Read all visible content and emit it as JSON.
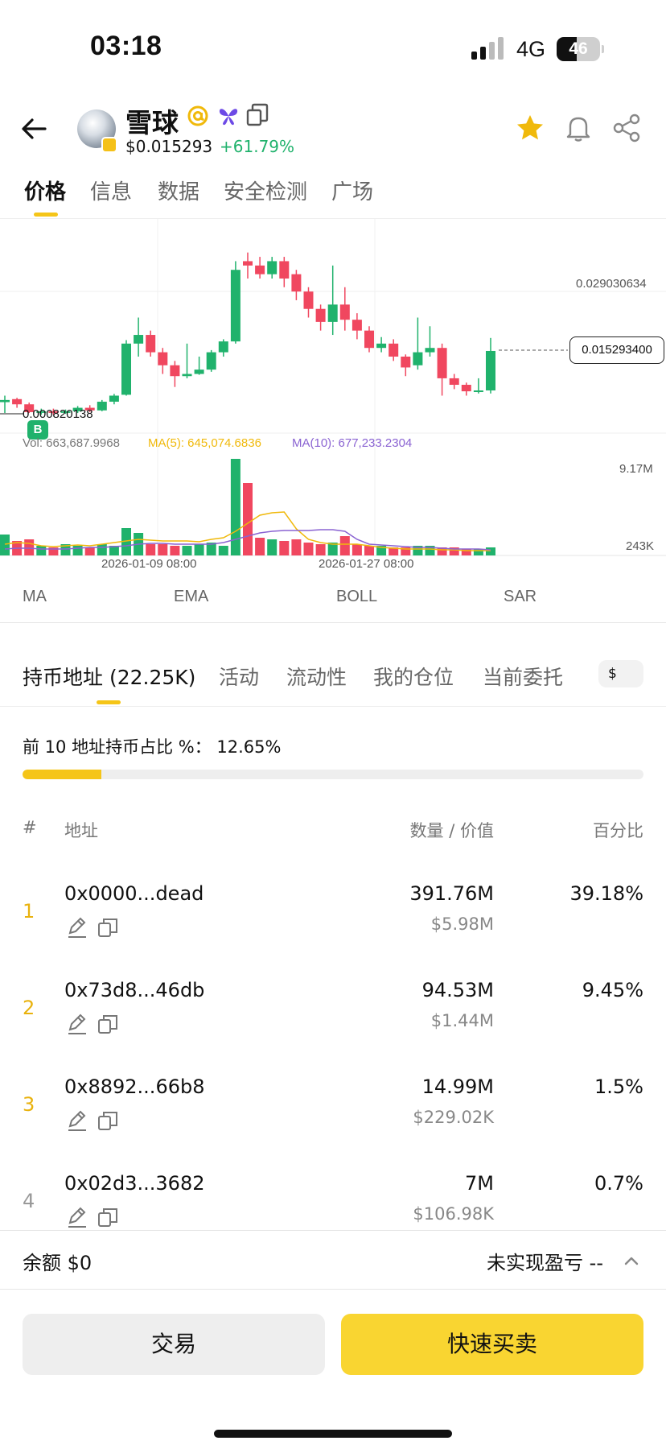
{
  "status": {
    "time": "03:18",
    "network": "4G",
    "battery": "46",
    "battery_level": 0.46
  },
  "header": {
    "token_name": "雪球",
    "price": "$0.015293",
    "change": "+61.79%"
  },
  "main_tabs": [
    "价格",
    "信息",
    "数据",
    "安全检测",
    "广场"
  ],
  "chart": {
    "price_high_label": "0.029030634",
    "current_price_label": "0.015293400",
    "low_price_label": "0.000820138",
    "buy_marker": "B",
    "vol_label": "Vol: 663,687.9968",
    "ma5_label": "MA(5): 645,074.6836",
    "ma10_label": "MA(10): 677,233.2304",
    "vol_high_label": "9.17M",
    "vol_low_label": "243K",
    "date_labels": [
      "2026-01-09 08:00",
      "2026-01-27 08:00"
    ]
  },
  "chart_data": {
    "type": "candlestick",
    "x": [
      "2026-01-09 08:00",
      "2026-01-27 08:00"
    ],
    "price_reference_lines": [
      0.029030634,
      0.0152934,
      0.000820138
    ],
    "current_price": 0.0152934,
    "volume_axis_labels": [
      "9.17M",
      "243K"
    ],
    "volume": 663687.9968,
    "ma5": 645074.6836,
    "ma10": 677233.2304,
    "colors": {
      "up": "#20b26c",
      "down": "#f0475f",
      "ma5": "#f0b90b",
      "ma10": "#8a63d2"
    }
  },
  "indicators": [
    "MA",
    "EMA",
    "BOLL",
    "SAR"
  ],
  "sub_tabs": [
    "持币地址 (22.25K)",
    "活动",
    "流动性",
    "我的仓位",
    "当前委托"
  ],
  "currency_chip": "$",
  "top10": {
    "label": "前 10 地址持币占比 %：  12.65%",
    "fraction": 0.1265
  },
  "table": {
    "headers": {
      "rank": "#",
      "address": "地址",
      "amount_value": "数量 / 价值",
      "percent": "百分比"
    },
    "rows": [
      {
        "rank": "1",
        "address": "0x0000...dead",
        "amount": "391.76M",
        "value": "$5.98M",
        "percent": "39.18%",
        "rank_color": "#e9b20e"
      },
      {
        "rank": "2",
        "address": "0x73d8...46db",
        "amount": "94.53M",
        "value": "$1.44M",
        "percent": "9.45%",
        "rank_color": "#e9b20e"
      },
      {
        "rank": "3",
        "address": "0x8892...66b8",
        "amount": "14.99M",
        "value": "$229.02K",
        "percent": "1.5%",
        "rank_color": "#e9b20e"
      },
      {
        "rank": "4",
        "address": "0x02d3...3682",
        "amount": "7M",
        "value": "$106.98K",
        "percent": "0.7%",
        "rank_color": "#999999"
      }
    ]
  },
  "footer": {
    "balance": "余额 $0",
    "pnl": "未实现盈亏 --",
    "trade_button": "交易",
    "quick_button": "快速买卖"
  }
}
